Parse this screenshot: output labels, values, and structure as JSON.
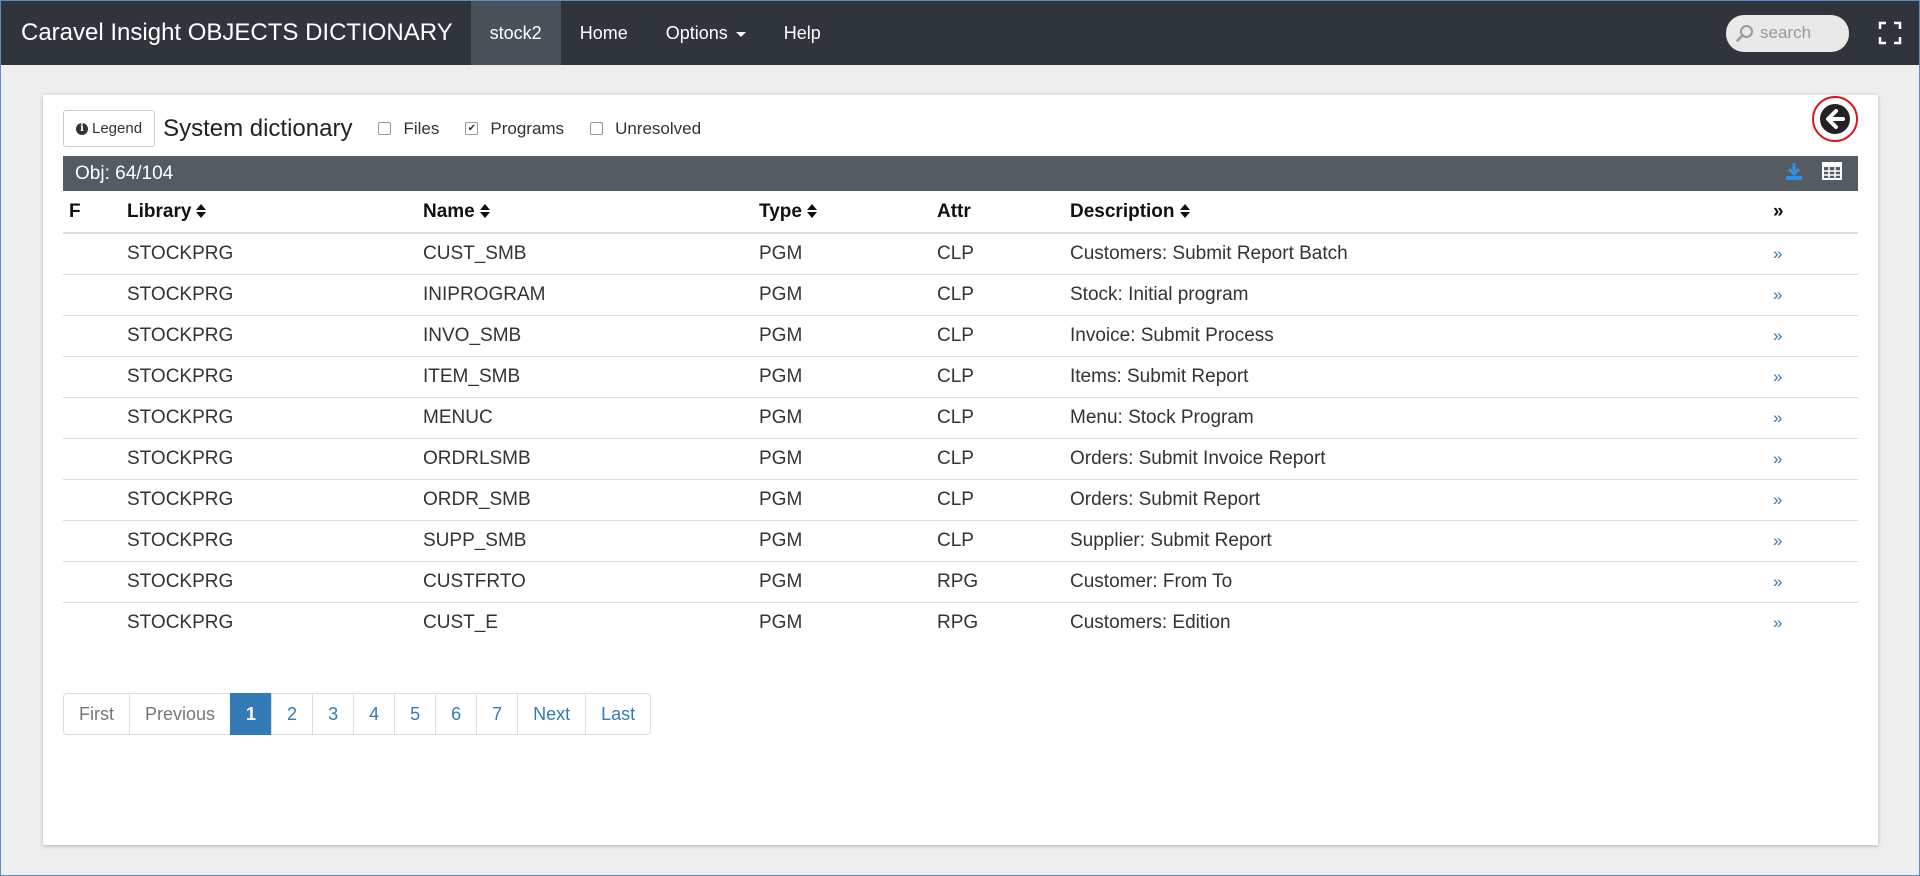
{
  "navbar": {
    "brand": "Caravel Insight OBJECTS DICTIONARY",
    "items": [
      {
        "label": "stock2",
        "active": true
      },
      {
        "label": "Home"
      },
      {
        "label": "Options",
        "dropdown": true
      },
      {
        "label": "Help"
      }
    ],
    "search_placeholder": "search"
  },
  "toolbar": {
    "legend_label": "Legend",
    "title": "System dictionary",
    "filters": [
      {
        "label": "Files",
        "checked": false
      },
      {
        "label": "Programs",
        "checked": true
      },
      {
        "label": "Unresolved",
        "checked": false
      }
    ]
  },
  "objbar": {
    "count_text": "Obj: 64/104"
  },
  "table": {
    "headers": {
      "f": "F",
      "library": "Library",
      "name": "Name",
      "type": "Type",
      "attr": "Attr",
      "description": "Description",
      "more": "»"
    },
    "rows": [
      {
        "library": "STOCKPRG",
        "name": "CUST_SMB",
        "type": "PGM",
        "attr": "CLP",
        "description": "Customers: Submit Report Batch"
      },
      {
        "library": "STOCKPRG",
        "name": "INIPROGRAM",
        "type": "PGM",
        "attr": "CLP",
        "description": "Stock: Initial program"
      },
      {
        "library": "STOCKPRG",
        "name": "INVO_SMB",
        "type": "PGM",
        "attr": "CLP",
        "description": "Invoice: Submit Process"
      },
      {
        "library": "STOCKPRG",
        "name": "ITEM_SMB",
        "type": "PGM",
        "attr": "CLP",
        "description": "Items: Submit Report"
      },
      {
        "library": "STOCKPRG",
        "name": "MENUC",
        "type": "PGM",
        "attr": "CLP",
        "description": "Menu: Stock Program"
      },
      {
        "library": "STOCKPRG",
        "name": "ORDRLSMB",
        "type": "PGM",
        "attr": "CLP",
        "description": "Orders: Submit Invoice Report"
      },
      {
        "library": "STOCKPRG",
        "name": "ORDR_SMB",
        "type": "PGM",
        "attr": "CLP",
        "description": "Orders: Submit Report"
      },
      {
        "library": "STOCKPRG",
        "name": "SUPP_SMB",
        "type": "PGM",
        "attr": "CLP",
        "description": "Supplier: Submit Report"
      },
      {
        "library": "STOCKPRG",
        "name": "CUSTFRTO",
        "type": "PGM",
        "attr": "RPG",
        "description": "Customer: From To"
      },
      {
        "library": "STOCKPRG",
        "name": "CUST_E",
        "type": "PGM",
        "attr": "RPG",
        "description": "Customers: Edition"
      }
    ],
    "row_link": "»"
  },
  "pagination": {
    "first": "First",
    "previous": "Previous",
    "pages": [
      "1",
      "2",
      "3",
      "4",
      "5",
      "6",
      "7"
    ],
    "current": "1",
    "next": "Next",
    "last": "Last"
  },
  "colors": {
    "navbar": "#2f353b",
    "objbar": "#545b61",
    "accent": "#337ab7",
    "back_ring": "#e0141e"
  }
}
